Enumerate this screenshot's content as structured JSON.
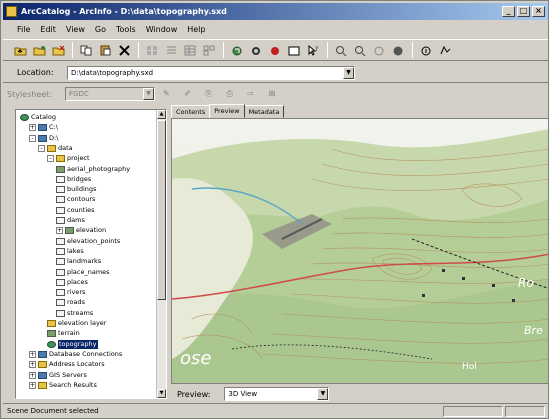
{
  "window": {
    "title": "ArcCatalog - ArcInfo - D:\\data\\topography.sxd",
    "controls": [
      "_",
      "□",
      "×"
    ]
  },
  "menu": [
    "File",
    "Edit",
    "View",
    "Go",
    "Tools",
    "Window",
    "Help"
  ],
  "toolbar": {
    "icons": [
      "up-folder-icon",
      "connect-folder-icon",
      "disconnect-folder-icon",
      "copy-icon",
      "paste-icon",
      "delete-icon",
      "large-icons-icon",
      "list-icon",
      "details-icon",
      "thumbnails-icon",
      "launch-arcmap-icon",
      "metadata-icon",
      "search-icon",
      "arctoolbox-icon",
      "whats-this-icon",
      "zoom-in-icon",
      "zoom-out-icon",
      "pan-icon",
      "full-extent-icon",
      "identify-icon",
      "globe-navigate-icon"
    ]
  },
  "location": {
    "label": "Location:",
    "value": "D:\\data\\topography.sxd"
  },
  "stylesheet": {
    "label": "Stylesheet:",
    "value": "FGDC"
  },
  "tree": [
    {
      "label": "Catalog",
      "level": 0,
      "icon": "globe",
      "exp": ""
    },
    {
      "label": "C:\\",
      "level": 1,
      "icon": "db",
      "exp": "+"
    },
    {
      "label": "D:\\",
      "level": 1,
      "icon": "db",
      "exp": "-"
    },
    {
      "label": "data",
      "level": 2,
      "icon": "folder",
      "exp": "-"
    },
    {
      "label": "project",
      "level": 3,
      "icon": "folder",
      "exp": "-"
    },
    {
      "label": "aerial_photography",
      "level": 4,
      "icon": "raster",
      "exp": ""
    },
    {
      "label": "bridges",
      "level": 4,
      "icon": "",
      "exp": ""
    },
    {
      "label": "buildings",
      "level": 4,
      "icon": "",
      "exp": ""
    },
    {
      "label": "contours",
      "level": 4,
      "icon": "",
      "exp": ""
    },
    {
      "label": "counties",
      "level": 4,
      "icon": "",
      "exp": ""
    },
    {
      "label": "dams",
      "level": 4,
      "icon": "",
      "exp": ""
    },
    {
      "label": "elevation",
      "level": 4,
      "icon": "raster",
      "exp": "+"
    },
    {
      "label": "elevation_points",
      "level": 4,
      "icon": "",
      "exp": ""
    },
    {
      "label": "lakes",
      "level": 4,
      "icon": "",
      "exp": ""
    },
    {
      "label": "landmarks",
      "level": 4,
      "icon": "",
      "exp": ""
    },
    {
      "label": "place_names",
      "level": 4,
      "icon": "",
      "exp": ""
    },
    {
      "label": "places",
      "level": 4,
      "icon": "",
      "exp": ""
    },
    {
      "label": "rivers",
      "level": 4,
      "icon": "",
      "exp": ""
    },
    {
      "label": "roads",
      "level": 4,
      "icon": "",
      "exp": ""
    },
    {
      "label": "streams",
      "level": 4,
      "icon": "",
      "exp": ""
    },
    {
      "label": "elevation layer",
      "level": 3,
      "icon": "folder",
      "exp": ""
    },
    {
      "label": "terrain",
      "level": 3,
      "icon": "raster",
      "exp": ""
    },
    {
      "label": "topography",
      "level": 3,
      "icon": "globe",
      "exp": "",
      "selected": true
    },
    {
      "label": "Database Connections",
      "level": 1,
      "icon": "db",
      "exp": "+"
    },
    {
      "label": "Address Locators",
      "level": 1,
      "icon": "folder",
      "exp": "+"
    },
    {
      "label": "GIS Servers",
      "level": 1,
      "icon": "db",
      "exp": "+"
    },
    {
      "label": "Search Results",
      "level": 1,
      "icon": "folder",
      "exp": "+"
    }
  ],
  "tabs": [
    {
      "label": "Contents",
      "active": false
    },
    {
      "label": "Preview",
      "active": true
    },
    {
      "label": "Metadata",
      "active": false
    }
  ],
  "map": {
    "place_labels": [
      "Ro",
      "Bre",
      "ose",
      "Hol"
    ],
    "colors": {
      "terrain_light": "#e6ead6",
      "terrain_green": "#a9c78f",
      "water": "#5aa7c4",
      "contour": "#b58a55",
      "road": "#d04a4a"
    }
  },
  "preview": {
    "label": "Preview:",
    "value": "3D View"
  },
  "status": {
    "text": "Scene Document selected"
  }
}
